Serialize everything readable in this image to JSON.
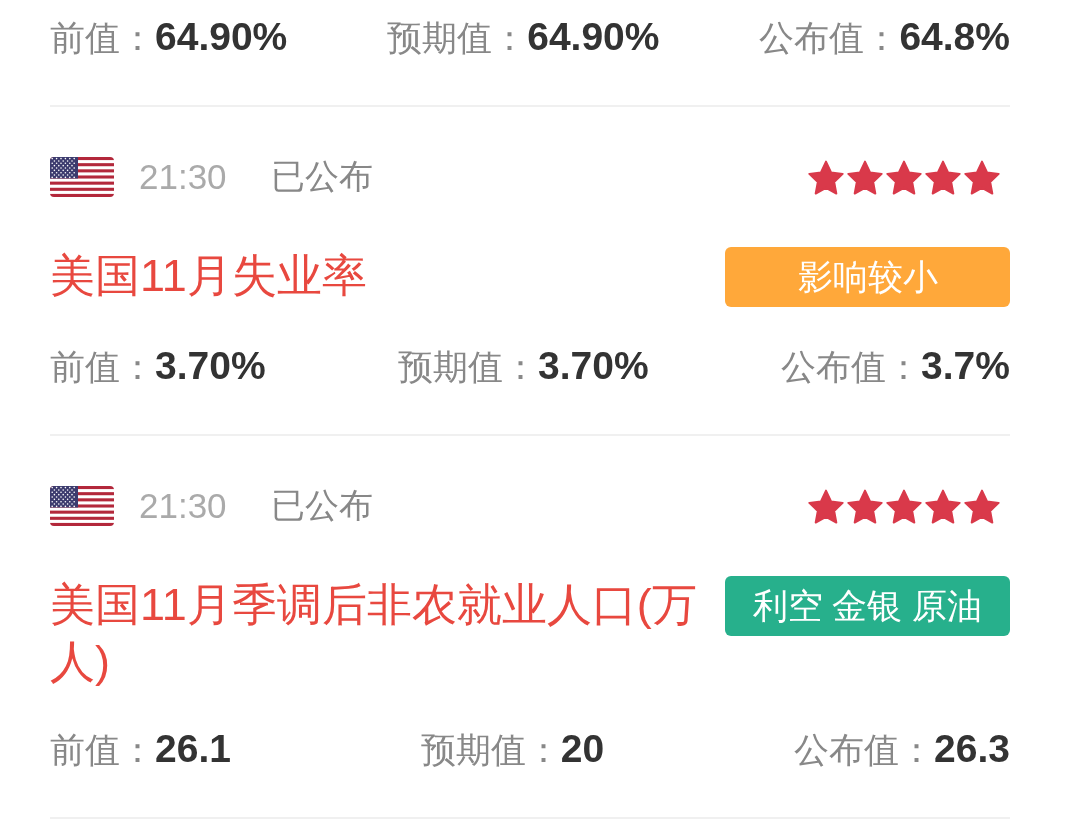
{
  "events": [
    {
      "values": [
        {
          "label": "前值：",
          "value": "64.90%"
        },
        {
          "label": "预期值：",
          "value": "64.90%"
        },
        {
          "label": "公布值：",
          "value": "64.8%"
        }
      ]
    },
    {
      "time": "21:30",
      "status": "已公布",
      "stars": 5,
      "title": "美国11月失业率",
      "tag": {
        "text": "影响较小",
        "color": "#ffa83a"
      },
      "values": [
        {
          "label": "前值：",
          "value": "3.70%"
        },
        {
          "label": "预期值：",
          "value": "3.70%"
        },
        {
          "label": "公布值：",
          "value": "3.7%"
        }
      ]
    },
    {
      "time": "21:30",
      "status": "已公布",
      "stars": 5,
      "title": "美国11月季调后非农就业人口(万人)",
      "tag": {
        "text": "利空 金银 原油",
        "color": "#27b08c"
      },
      "values": [
        {
          "label": "前值：",
          "value": "26.1"
        },
        {
          "label": "预期值：",
          "value": "20"
        },
        {
          "label": "公布值：",
          "value": "26.3"
        }
      ]
    }
  ]
}
